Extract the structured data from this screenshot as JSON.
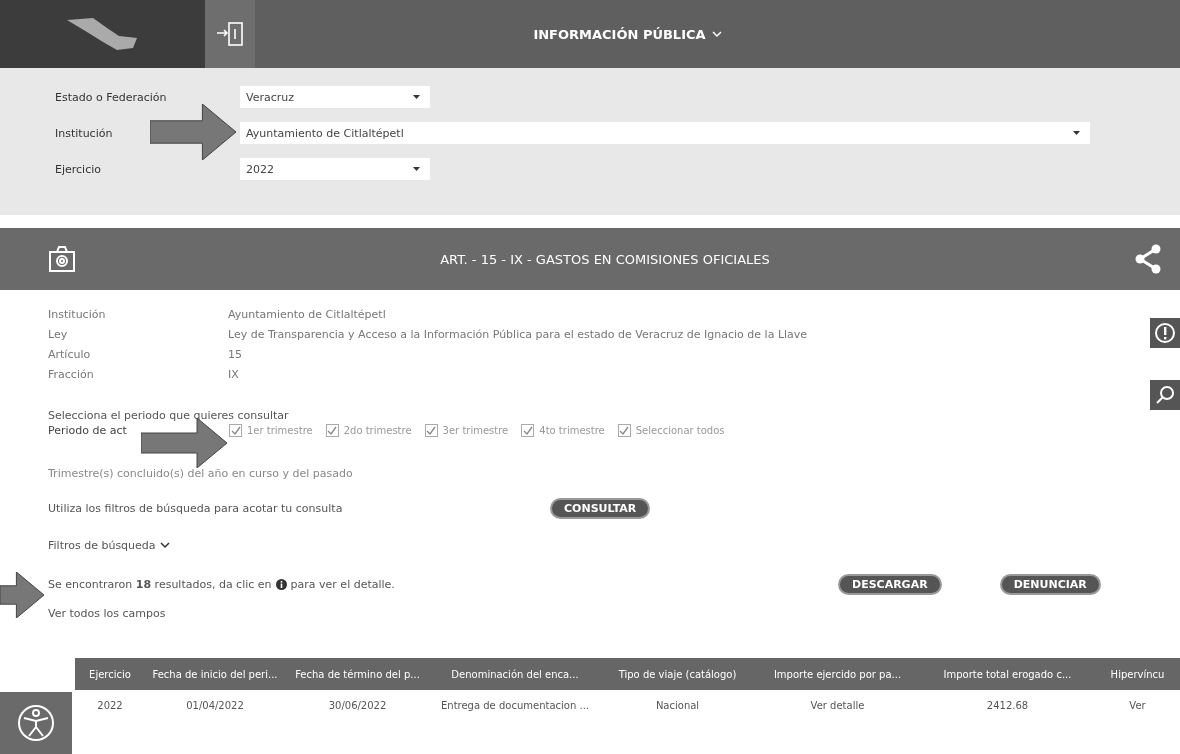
{
  "header": {
    "title": "INFORMACIÓN PÚBLICA"
  },
  "filters": [
    {
      "label": "Estado o Federación",
      "value": "Veracruz"
    },
    {
      "label": "Institución",
      "value": "Ayuntamiento de Citlaltépetl"
    },
    {
      "label": "Ejercicio",
      "value": "2022"
    }
  ],
  "section": {
    "title": "ART. - 15 - IX - GASTOS EN COMISIONES OFICIALES",
    "info": [
      {
        "label": "Institución",
        "value": "Ayuntamiento de Citlaltépetl"
      },
      {
        "label": "Ley",
        "value": "Ley de Transparencia y Acceso a la Información Pública para el estado de Veracruz de Ignacio de la Llave"
      },
      {
        "label": "Artículo",
        "value": "15"
      },
      {
        "label": "Fracción",
        "value": "IX"
      }
    ],
    "period_prompt": "Selecciona el periodo que quieres consultar",
    "period_label": "Periodo de act",
    "periods": [
      {
        "label": "1er trimestre",
        "checked": true
      },
      {
        "label": "2do trimestre",
        "checked": true
      },
      {
        "label": "3er trimestre",
        "checked": true
      },
      {
        "label": "4to trimestre",
        "checked": true
      },
      {
        "label": "Seleccionar todos",
        "checked": true
      }
    ],
    "period_note": "Trimestre(s) concluido(s) del año en curso y del pasado",
    "filter_hint": "Utiliza los filtros de búsqueda para acotar tu consulta",
    "consult_button": "CONSULTAR",
    "filters_toggle": "Filtros de búsqueda",
    "results_text": "Se encontraron **18** resultados, da clic en",
    "results_text_end": "para ver el detalle.",
    "buttons": [
      "DESCARGAR",
      "DENUNCIAR"
    ],
    "show_all": "Ver todos los campos"
  },
  "table": {
    "columns": [
      "Ejercicio",
      "Fecha de inicio del peri...",
      "Fecha de término del p...",
      "Denominación del enca...",
      "Tipo de viaje (catálogo)",
      "Importe ejercido por pa...",
      "Importe total erogado c...",
      "Hipervíncu"
    ],
    "rows": [
      [
        "2022",
        "01/04/2022",
        "30/06/2022",
        "Entrega de documentacion ...",
        "Nacional",
        "Ver detalle",
        "2412.68",
        "Ver"
      ]
    ]
  }
}
